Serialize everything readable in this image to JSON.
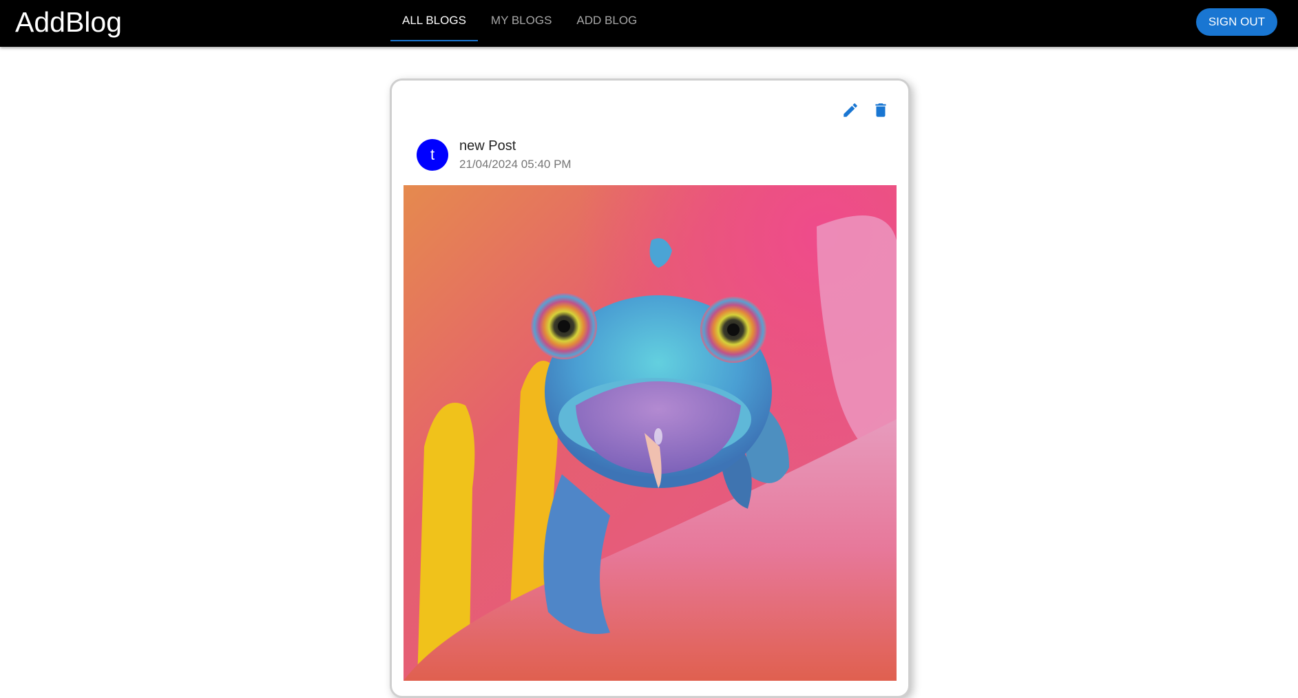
{
  "header": {
    "brand": "AddBlog",
    "tabs": [
      {
        "label": "ALL BLOGS",
        "active": true
      },
      {
        "label": "MY BLOGS",
        "active": false
      },
      {
        "label": "ADD BLOG",
        "active": false
      }
    ],
    "signout_label": "SIGN OUT"
  },
  "post": {
    "avatar_letter": "t",
    "title": "new Post",
    "date": "21/04/2024 05:40 PM",
    "actions": {
      "edit_icon": "edit-icon",
      "delete_icon": "delete-icon"
    },
    "image": "chameleon-on-pink-flower"
  },
  "colors": {
    "appbar": "#000000",
    "accent": "#1976d2",
    "avatar": "#0000ff"
  }
}
